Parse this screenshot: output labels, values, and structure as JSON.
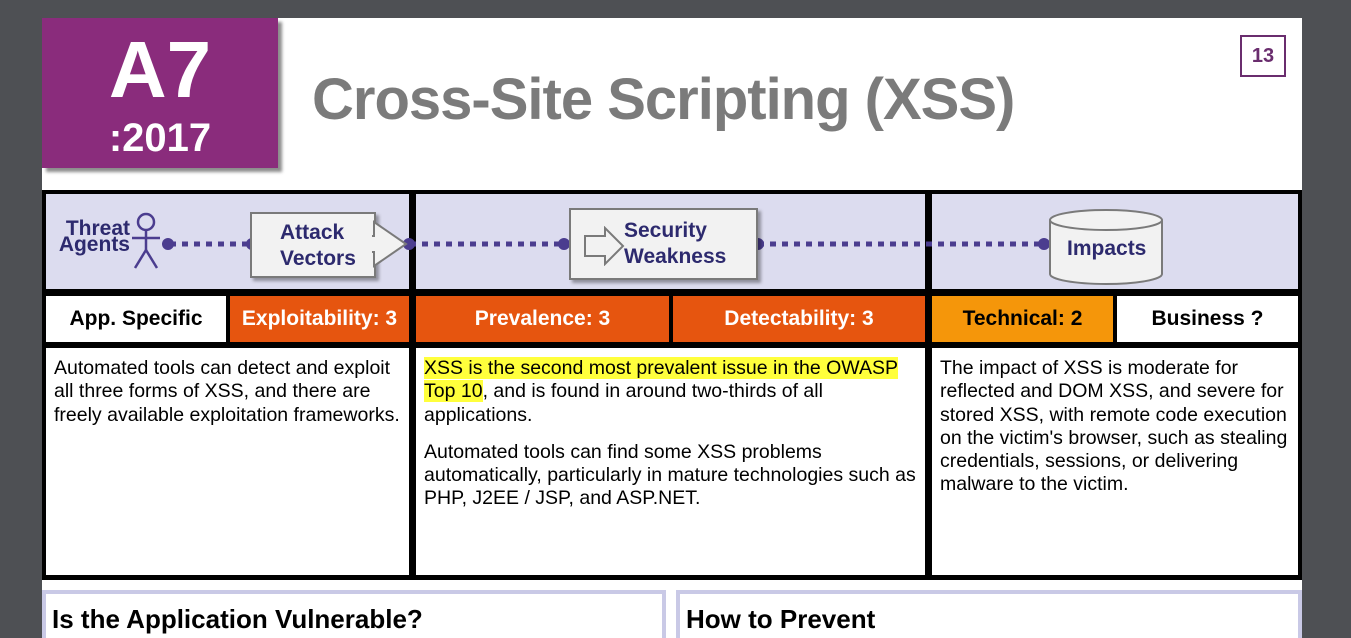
{
  "badge": {
    "code": "A7",
    "year": ":2017"
  },
  "title": "Cross-Site Scripting (XSS)",
  "page_number": "13",
  "flow": {
    "threat_agents": [
      "Threat",
      "Agents"
    ],
    "attack_vectors": [
      "Attack",
      "Vectors"
    ],
    "security_weakness": [
      "Security",
      "Weakness"
    ],
    "impacts": "Impacts"
  },
  "headers": {
    "app_specific": "App. Specific",
    "exploitability": "Exploitability: 3",
    "prevalence": "Prevalence: 3",
    "detectability": "Detectability: 3",
    "technical": "Technical: 2",
    "business": "Business ?"
  },
  "text": {
    "exploit": "Automated tools can detect and exploit all three forms of XSS, and there are freely available exploitation frameworks.",
    "weak_highlight": "XSS is the second most prevalent issue in the OWASP Top 10",
    "weak_rest": ", and is found in around two-thirds of all applications.",
    "weak_p2": "Automated tools can find some XSS problems automatically, particularly in mature technologies such as PHP, J2EE / JSP, and ASP.NET.",
    "impact": "The impact of XSS is moderate for reflected and DOM XSS, and severe for stored XSS, with remote code execution on the victim's browser, such as stealing credentials, sessions, or delivering malware to the victim."
  },
  "sections": {
    "vulnerable": "Is the Application Vulnerable?",
    "prevent": "How to Prevent"
  },
  "colors": {
    "badge": "#8a2c7c",
    "orange": "#e6550f",
    "amber": "#f5960a",
    "flow_bg": "#dcdcef",
    "highlight": "#ffff3c",
    "dots": "#4b3d8f"
  }
}
